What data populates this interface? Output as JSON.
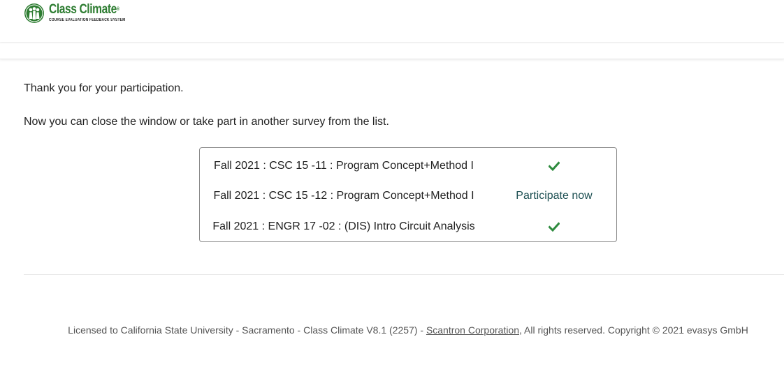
{
  "header": {
    "logo": {
      "name": "Class Climate",
      "registered_mark": "®",
      "tagline": "COURSE EVALUATION FEEDBACK SYSTEM",
      "brand_color": "#2e7d32"
    }
  },
  "main": {
    "thank_you": "Thank you for your participation.",
    "instruction": "Now you can close the window or take part in another survey from the list.",
    "surveys": [
      {
        "name": "Fall 2021 : CSC 15 -11 : Program Concept+Method I",
        "status": "completed",
        "status_icon": "check-icon"
      },
      {
        "name": "Fall 2021 : CSC 15 -12 : Program Concept+Method I",
        "status": "open",
        "action_label": "Participate now"
      },
      {
        "name": "Fall 2021 : ENGR 17 -02 : (DIS) Intro Circuit Analysis",
        "status": "completed",
        "status_icon": "check-icon"
      }
    ],
    "check_color": "#2e8b3e",
    "link_color": "#1c4f52"
  },
  "footer": {
    "text_before": "Licensed to California State University - Sacramento - Class Climate V8.1 (2257) - ",
    "link_text": "Scantron Corporation",
    "text_after": ", All rights reserved. Copyright © 2021 evasys GmbH"
  }
}
